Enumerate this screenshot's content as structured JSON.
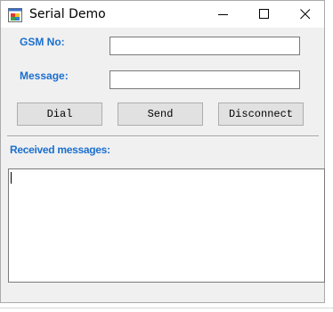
{
  "window": {
    "title": "Serial Demo",
    "app_icon": "winforms-app-icon",
    "controls": {
      "minimize_icon": "minimize-icon",
      "maximize_icon": "maximize-icon",
      "close_icon": "close-icon"
    }
  },
  "form": {
    "gsm_label": "GSM No:",
    "gsm_value": "",
    "message_label": "Message:",
    "message_value": "",
    "buttons": {
      "dial": "Dial",
      "send": "Send",
      "disconnect": "Disconnect"
    },
    "received_label": "Received messages:",
    "received_value": ""
  },
  "colors": {
    "label_blue": "#1a6fcf",
    "window_bg": "#f0f0f0",
    "button_bg": "#e1e1e1"
  }
}
